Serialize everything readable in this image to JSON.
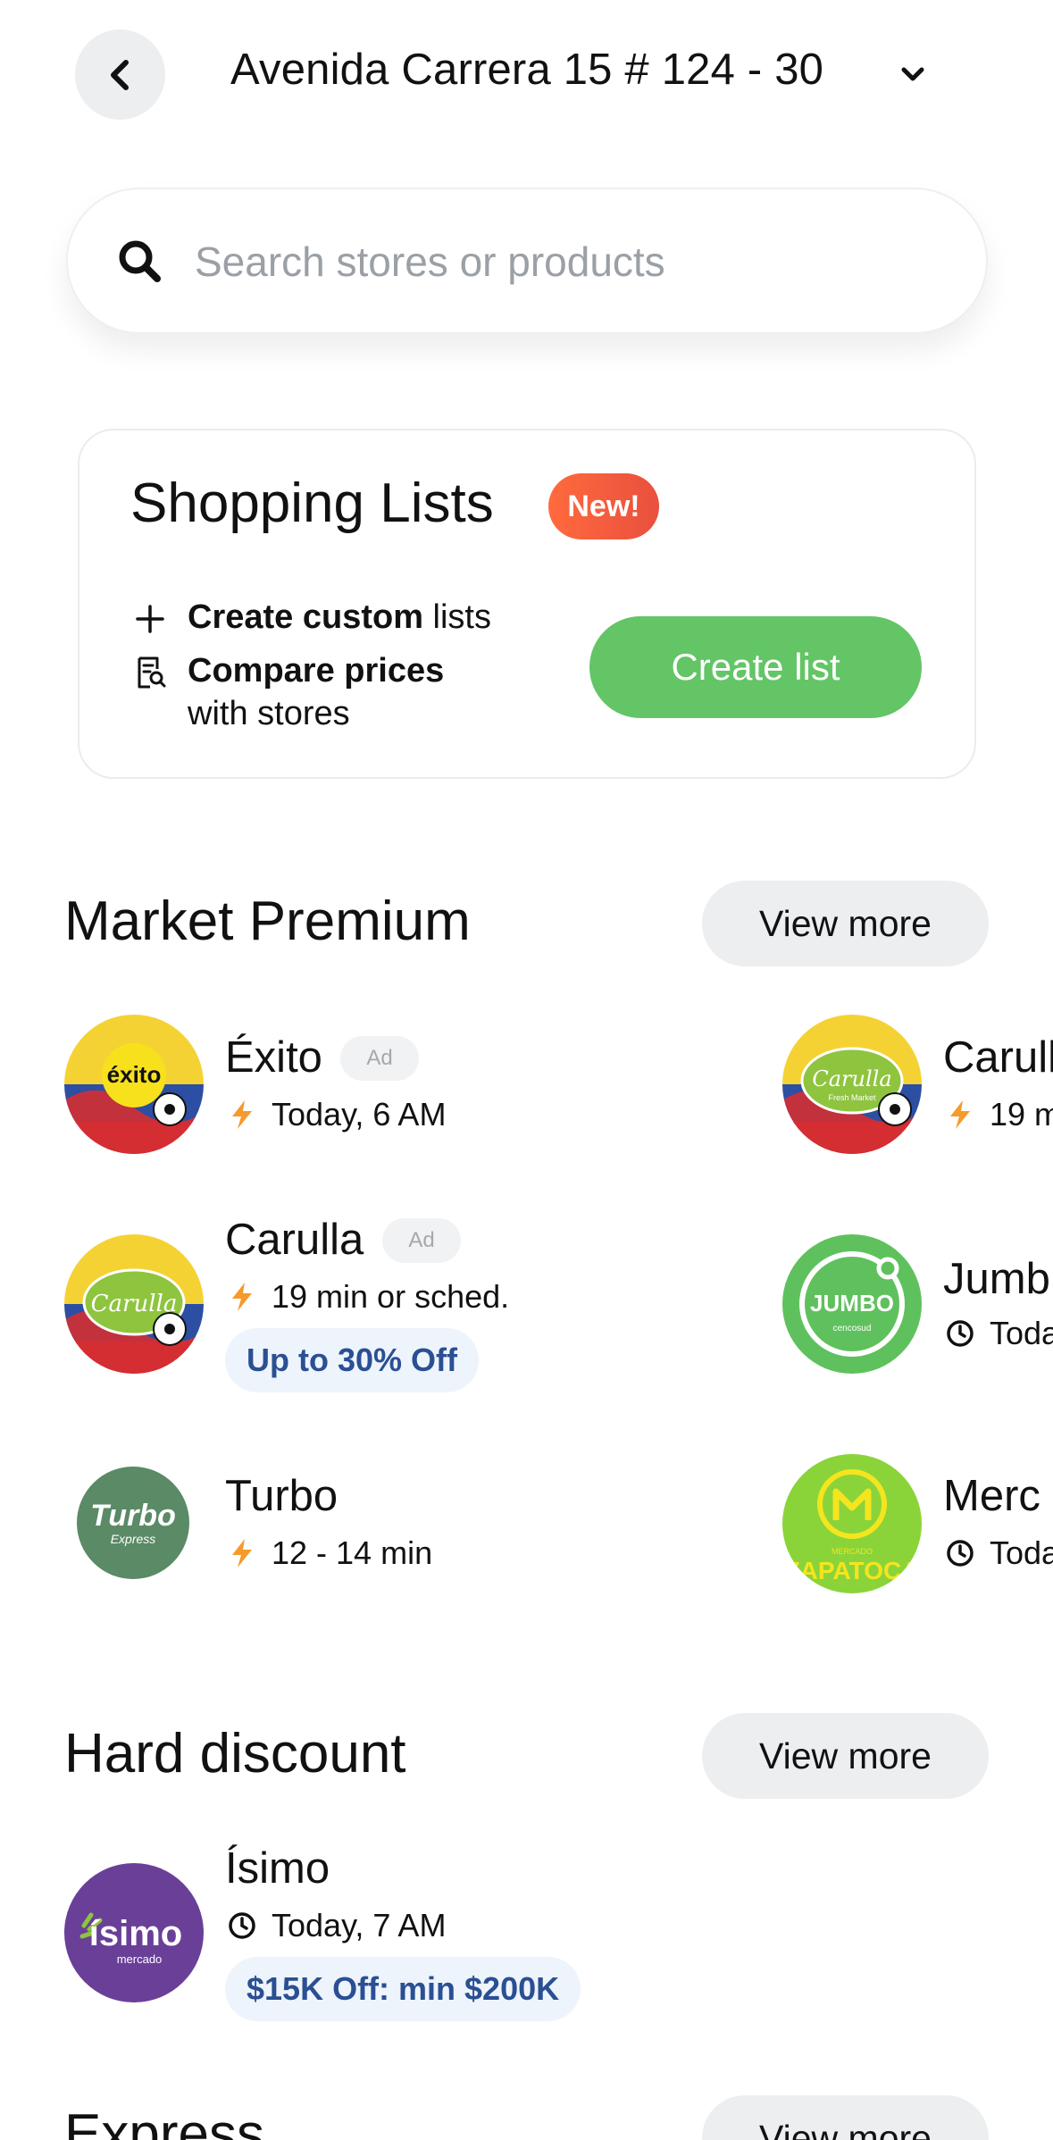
{
  "header": {
    "address": "Avenida Carrera 15 # 124 - 30"
  },
  "search": {
    "placeholder": "Search stores or products"
  },
  "shopping_lists": {
    "title": "Shopping Lists",
    "badge": "New!",
    "feature1_bold": "Create custom",
    "feature1_rest": " lists",
    "feature2_bold": "Compare prices",
    "feature2_rest": "with stores",
    "button": "Create list"
  },
  "market_premium": {
    "title": "Market Premium",
    "view_more": "View more",
    "stores": [
      {
        "name": "Éxito",
        "ad": "Ad",
        "meta": "Today, 6 AM",
        "logo_text": "éxito"
      },
      {
        "name": "Carulla",
        "ad": "Ad",
        "meta": "19 min or sched.",
        "promo": "Up to 30% Off",
        "logo_text": "Carulla"
      },
      {
        "name": "Turbo",
        "meta": "12 - 14 min",
        "logo_text": "Turbo",
        "logo_sub": "Express"
      },
      {
        "name": "Carulla",
        "meta": "19 m",
        "logo_text": "Carulla",
        "logo_sub": "Fresh Market"
      },
      {
        "name": "Jumb",
        "meta": "Toda",
        "logo_text": "JUMBO",
        "logo_sub": "cencosud"
      },
      {
        "name": "Merc",
        "meta": "Toda",
        "logo_text": "ZAPATOCA",
        "logo_sub": "MERCADO"
      }
    ]
  },
  "hard_discount": {
    "title": "Hard discount",
    "view_more": "View more",
    "stores": [
      {
        "name": "Ísimo",
        "meta": "Today, 7 AM",
        "promo": "$15K Off: min $200K",
        "logo_text": "ísimo",
        "logo_sub": "mercado"
      }
    ]
  },
  "express": {
    "title": "Express",
    "view_more": "View more"
  },
  "colors": {
    "accent_green": "#63c566",
    "badge_orange": "#ee5a3c",
    "promo_blue": "#2a4f93",
    "bolt": "#f59a2b"
  }
}
